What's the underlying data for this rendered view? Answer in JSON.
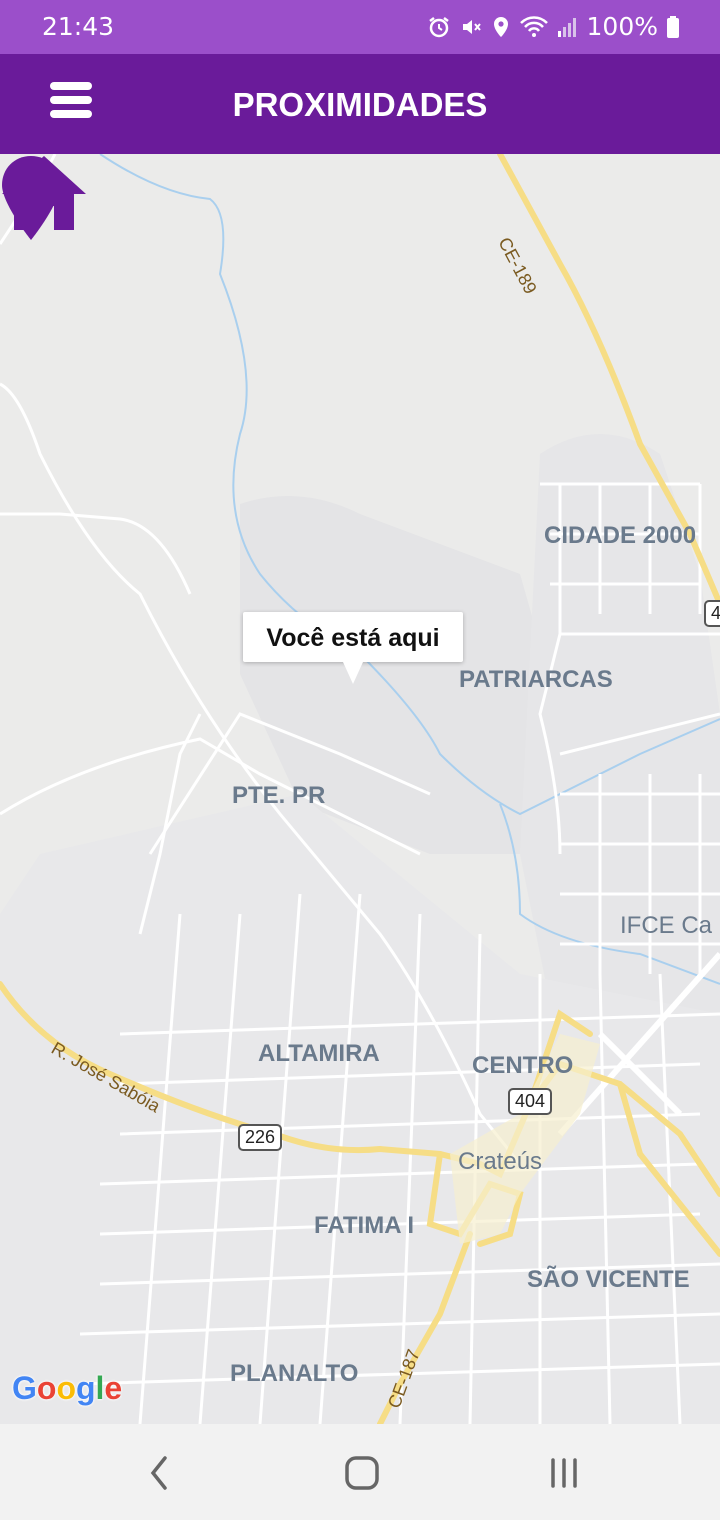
{
  "status_bar": {
    "time": "21:43",
    "battery": "100%",
    "icons": [
      "alarm-icon",
      "mute-icon",
      "location-icon",
      "wifi-icon",
      "signal-icon",
      "battery-icon"
    ]
  },
  "app_bar": {
    "title": "PROXIMIDADES",
    "menu_icon": "hamburger-menu-icon",
    "color": "#6a1b9a"
  },
  "map": {
    "callout_text": "Você está aqui",
    "marker_color": "#6a1b9a",
    "area_labels": [
      "CIDADE 2000",
      "PATRIARCAS",
      "PTE. PR",
      "IFCE Ca",
      "ALTAMIRA",
      "CENTRO",
      "Crateús",
      "FATIMA I",
      "SÃO VICENTE",
      "PLANALTO"
    ],
    "road_labels": [
      "CE-189",
      "R. José Sabóia",
      "CE-187"
    ],
    "road_shields": [
      "404",
      "226",
      "4"
    ],
    "attribution": "Google"
  },
  "nav_bar": {
    "back": "back-icon",
    "home": "home-circle-icon",
    "recents": "recents-icon"
  }
}
